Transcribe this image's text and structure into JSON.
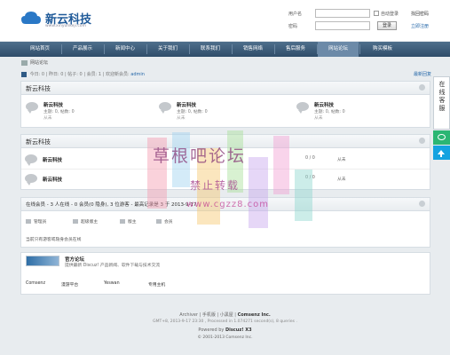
{
  "header": {
    "logo_title": "新云科技",
    "logo_url_text": "www.xinyunkeji.com",
    "login": {
      "username_label": "用户名",
      "password_label": "密码",
      "auto_login": "自动登录",
      "login_button": "登录",
      "forgot_password": "找回密码",
      "register": "立即注册"
    }
  },
  "nav": {
    "items": [
      "网站首页",
      "产品展示",
      "新闻中心",
      "关于我们",
      "联系我们",
      "销售网络",
      "售后服务",
      "网站论坛",
      "购买模板"
    ],
    "active_index": 7
  },
  "crumb": {
    "label": "网站论坛"
  },
  "stats": {
    "text_today": "今日: 0",
    "text_yesterday": "昨日: 0",
    "text_posts": "帖子: 0",
    "text_members": "会员: 1",
    "welcome_prefix": "欢迎新会员:",
    "newest_member": "admin",
    "latest_reply": "最新回复"
  },
  "section1": {
    "title": "新云科技",
    "forums": [
      {
        "name": "新云科技",
        "stat": "主题: 0, 帖数: 0",
        "last": "从未"
      },
      {
        "name": "新云科技",
        "stat": "主题: 0, 帖数: 0",
        "last": "从未"
      },
      {
        "name": "新云科技",
        "stat": "主题: 0, 帖数: 0",
        "last": "从未"
      }
    ]
  },
  "section2": {
    "title": "新云科技",
    "rows": [
      {
        "name": "新云科技",
        "count": "0 / 0",
        "last": "从未"
      },
      {
        "name": "新云科技",
        "count": "0 / 0",
        "last": "从未"
      }
    ]
  },
  "online": {
    "head": "在线会员 - 3 人在线 - 0 会员(0 隐身), 3 位游客 - 最高记录是 3 于 2013-9-17.",
    "legend": [
      "管理员",
      "超级版主",
      "版主",
      "会员"
    ],
    "note": "当前只有游客或隐身会员在线"
  },
  "friends": {
    "name": "官方论坛",
    "desc": "提供最新 Discuz! 产品新闻、软件下载与技术交流",
    "links": [
      "Comsenz",
      "漫游平台",
      "Yeswan",
      "专用主机"
    ]
  },
  "footer": {
    "links": "Archiver | 手机版 | 小黑屋 |",
    "company": "Comsenz Inc.",
    "gmt": "GMT+8, 2013-9-17 23:30 , Processed in 1.074271 second(s), 8 queries .",
    "powered_prefix": "Powered by",
    "powered_brand": "Discuz! X3",
    "copyright": "© 2001-2013 Comsenz Inc."
  },
  "side_service": {
    "text": "在线客服"
  },
  "watermark": {
    "title": "草根吧论坛",
    "subtitle": "禁止转载",
    "url": "www.cgzz8.com"
  }
}
